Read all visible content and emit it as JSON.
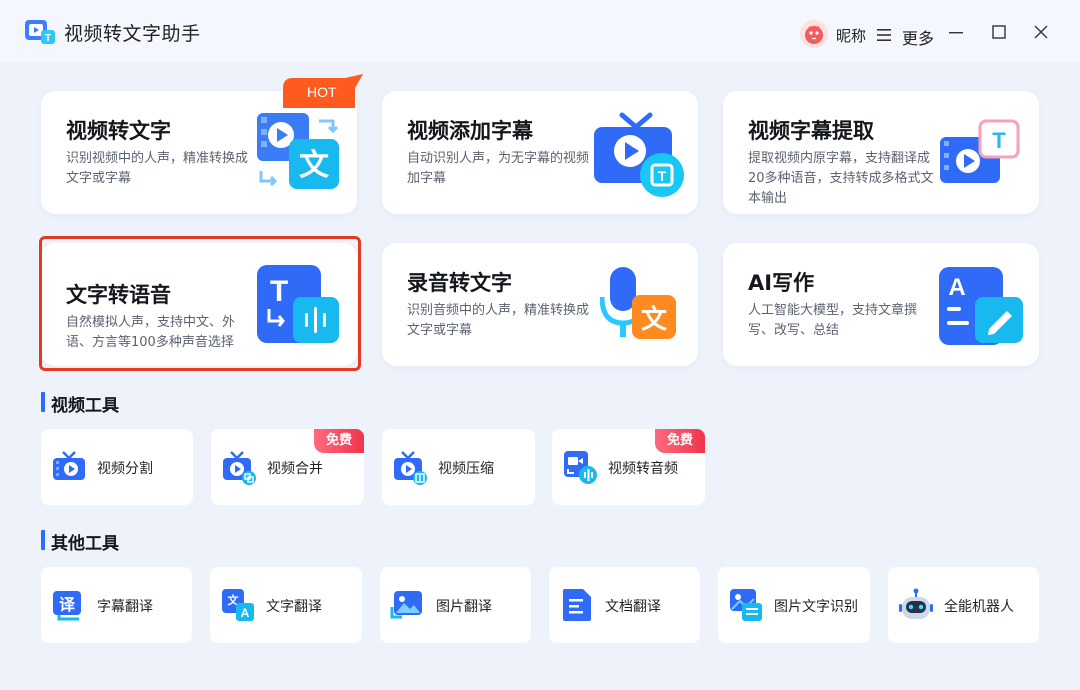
{
  "window": {
    "title": "视频转文字助手",
    "user_nickname": "昵称",
    "more_label": "更多"
  },
  "feature_cards": [
    {
      "title": "视频转文字",
      "desc": "识别视频中的人声，精准转换成文字或字幕",
      "badge": "HOT"
    },
    {
      "title": "视频添加字幕",
      "desc": "自动识别人声，为无字幕的视频加字幕"
    },
    {
      "title": "视频字幕提取",
      "desc": "提取视频内原字幕，支持翻译成20多种语音，支持转成多格式文本输出"
    },
    {
      "title": "文字转语音",
      "desc": "自然模拟人声，支持中文、外语、方言等100多种声音选择",
      "selected": true
    },
    {
      "title": "录音转文字",
      "desc": "识别音频中的人声，精准转换成文字或字幕"
    },
    {
      "title": "AI写作",
      "desc": "人工智能大模型，支持文章撰写、改写、总结"
    }
  ],
  "video_tools": {
    "title": "视频工具",
    "items": [
      {
        "label": "视频分割"
      },
      {
        "label": "视频合并",
        "badge": "免费"
      },
      {
        "label": "视频压缩"
      },
      {
        "label": "视频转音频",
        "badge": "免费"
      }
    ]
  },
  "other_tools": {
    "title": "其他工具",
    "items": [
      {
        "label": "字幕翻译"
      },
      {
        "label": "文字翻译"
      },
      {
        "label": "图片翻译"
      },
      {
        "label": "文档翻译"
      },
      {
        "label": "图片文字识别"
      },
      {
        "label": "全能机器人"
      }
    ]
  },
  "icon_texts": {
    "wen": "文",
    "t_letter": "T",
    "a_letter": "A",
    "yi": "译"
  },
  "colors": {
    "accent": "#2f6bf6",
    "selected_border": "#e23b22",
    "hot_badge": "#ff5a1f",
    "free_badge": "#f0344d"
  }
}
